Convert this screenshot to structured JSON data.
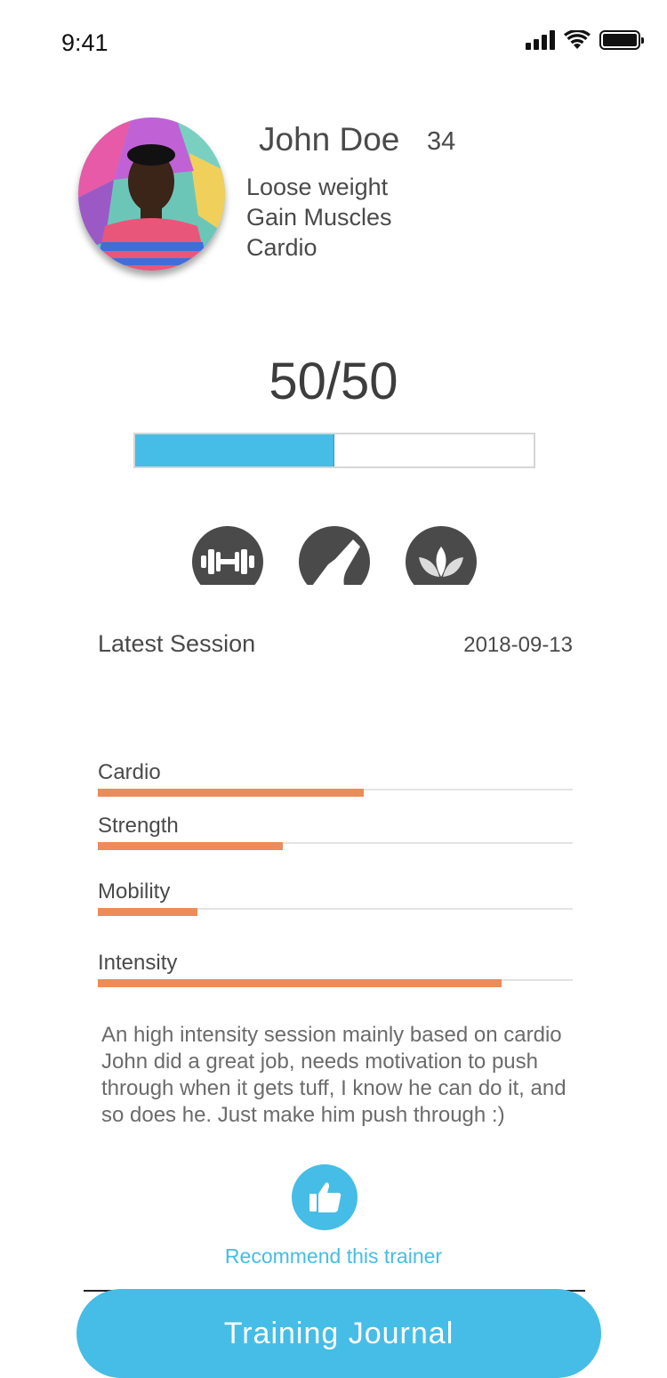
{
  "status_bar": {
    "time": "9:41",
    "icons": [
      "signal-icon",
      "wifi-icon",
      "battery-icon"
    ]
  },
  "profile": {
    "name": "John Doe",
    "age": "34",
    "goals": [
      "Loose weight",
      "Gain Muscles",
      "Cardio"
    ]
  },
  "progress": {
    "text": "50/50",
    "fraction": 0.5
  },
  "categories": [
    {
      "icon": "dumbbell-icon"
    },
    {
      "icon": "shoe-icon"
    },
    {
      "icon": "lotus-icon"
    }
  ],
  "session": {
    "title": "Latest Session",
    "date": "2018-09-13",
    "metrics": [
      {
        "label": "Cardio",
        "level": 0.56
      },
      {
        "label": "Strength",
        "level": 0.39
      },
      {
        "label": "Mobility",
        "level": 0.21
      },
      {
        "label": "Intensity",
        "level": 0.85
      }
    ],
    "notes": [
      "An high intensity session mainly based on cardio",
      "John did a great job, needs motivation to push through when it gets tuff, I know he can do it, and so does he. Just make him push through :)"
    ]
  },
  "recommend": {
    "icon": "thumbs-up-icon",
    "label": "Recommend this trainer"
  },
  "journal_button": {
    "label": "Training Journal"
  },
  "colors": {
    "accent": "#46bde6",
    "metric_fill": "#ee8b5a",
    "icon_disc": "#4a4a4a"
  }
}
